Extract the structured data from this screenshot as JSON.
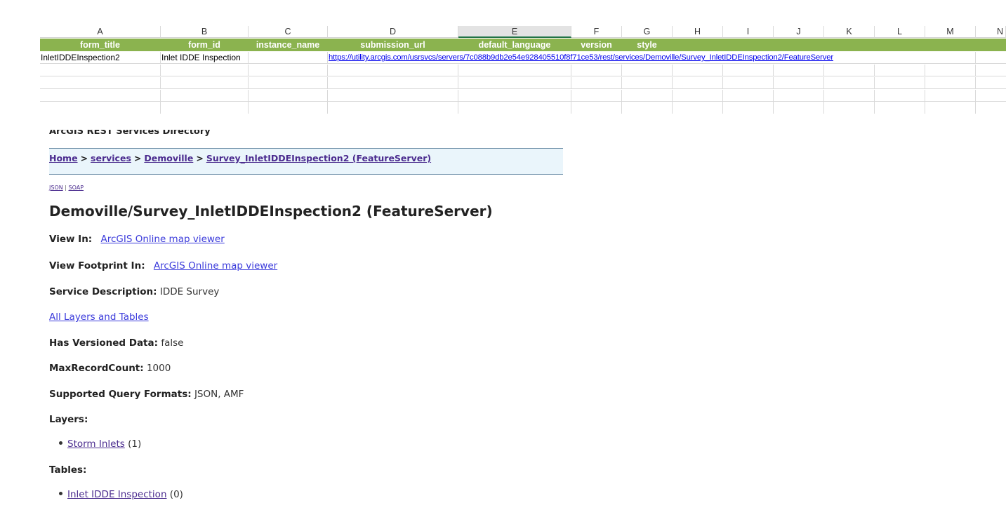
{
  "spreadsheet": {
    "columns": [
      "A",
      "B",
      "C",
      "D",
      "E",
      "F",
      "G",
      "H",
      "I",
      "J",
      "K",
      "L",
      "M",
      "N"
    ],
    "selected_column": "E",
    "fields": [
      "form_title",
      "form_id",
      "instance_name",
      "submission_url",
      "default_language",
      "version",
      "style"
    ],
    "row1": {
      "form_title": "InletIDDEInspection2",
      "form_id": "Inlet IDDE Inspection",
      "instance_name": "",
      "submission_url": "https://utility.arcgis.com/usrsvcs/servers/7c088b9db2e54e928405510f8f71ce53/rest/services/Demoville/Survey_InletIDDEInspection2/FeatureServer"
    },
    "colors": {
      "field_header_bg": "#8bb34f",
      "selected_col_border": "#217346"
    }
  },
  "rest": {
    "directory_title": "ArcGIS REST Services Directory",
    "breadcrumb": [
      "Home",
      "services",
      "Demoville",
      "Survey_InletIDDEInspection2 (FeatureServer)"
    ],
    "breadcrumb_sep": ">",
    "formats": [
      "JSON",
      "SOAP"
    ],
    "formats_sep": "|",
    "service_title": "Demoville/Survey_InletIDDEInspection2 (FeatureServer)",
    "view_in_label": "View In:",
    "view_in_link": "ArcGIS Online map viewer",
    "view_footprint_label": "View Footprint In:",
    "view_footprint_link": "ArcGIS Online map viewer",
    "service_description_label": "Service Description:",
    "service_description_value": "IDDE Survey",
    "all_layers_link": "All Layers and Tables",
    "has_versioned_label": "Has Versioned Data:",
    "has_versioned_value": "false",
    "max_record_label": "MaxRecordCount:",
    "max_record_value": "1000",
    "query_formats_label": "Supported Query Formats:",
    "query_formats_value": "JSON, AMF",
    "layers_label": "Layers:",
    "layers": [
      {
        "name": "Storm Inlets",
        "id": "(1)"
      }
    ],
    "tables_label": "Tables:",
    "tables": [
      {
        "name": "Inlet IDDE Inspection",
        "id": "(0)"
      }
    ]
  }
}
